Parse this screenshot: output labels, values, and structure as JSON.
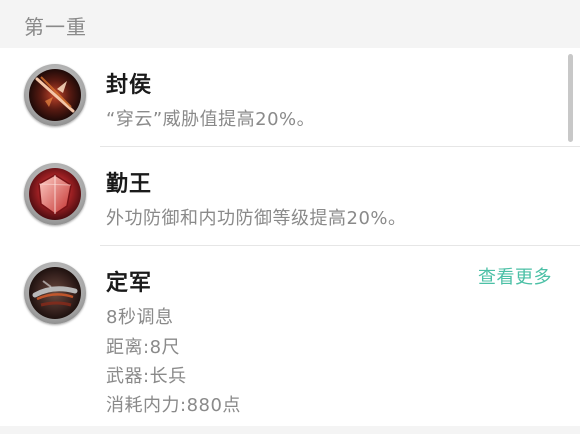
{
  "section": {
    "title": "第一重"
  },
  "skills": [
    {
      "name": "封侯",
      "description": "“穿云”威胁值提高20%。",
      "icon": "spear-strike-icon"
    },
    {
      "name": "勤王",
      "description": "外功防御和内功防御等级提高20%。",
      "icon": "red-shield-icon"
    },
    {
      "name": "定军",
      "more_label": "查看更多",
      "icon": "blade-slash-icon",
      "details": [
        "8秒调息",
        "距离:8尺",
        "武器:长兵",
        "消耗内力:880点"
      ]
    }
  ],
  "colors": {
    "accent": "#4cc0a6",
    "header_bg": "#f4f4f4",
    "title_text": "#1a1a1a",
    "secondary_text": "#8a8a8a"
  }
}
